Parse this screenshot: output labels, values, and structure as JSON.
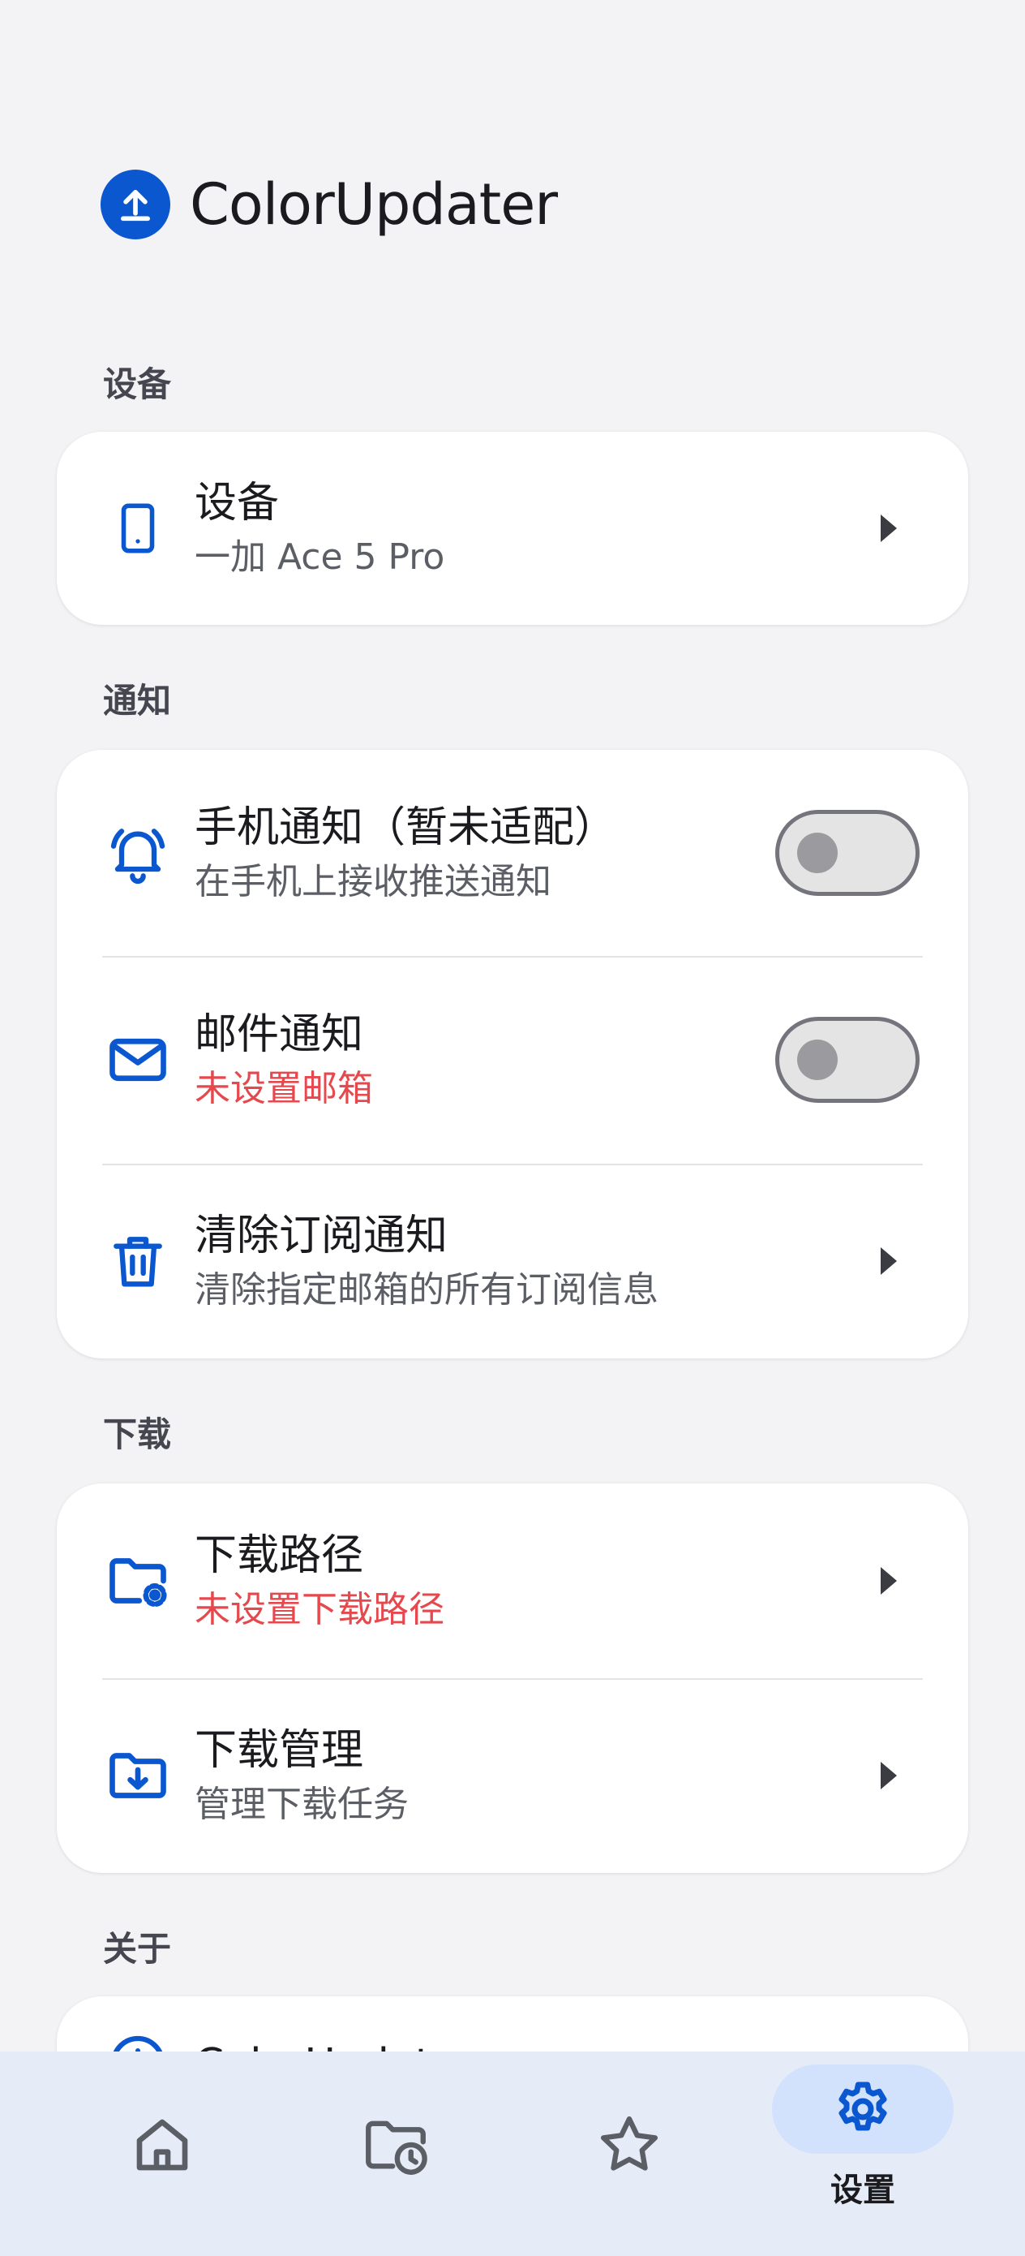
{
  "app": {
    "title": "ColorUpdater",
    "logo_icon": "upload-circle-icon",
    "accent": "#0b57d0",
    "warn_color": "#e5484d"
  },
  "sections": {
    "device": {
      "label": "设备",
      "items": [
        {
          "icon": "phone-icon",
          "title": "设备",
          "subtitle": "一加 Ace 5 Pro"
        }
      ]
    },
    "notify": {
      "label": "通知",
      "items": [
        {
          "icon": "bell-icon",
          "title": "手机通知（暂未适配）",
          "subtitle": "在手机上接收推送通知",
          "toggle": false
        },
        {
          "icon": "mail-icon",
          "title": "邮件通知",
          "subtitle": "未设置邮箱",
          "toggle": false
        },
        {
          "icon": "trash-icon",
          "title": "清除订阅通知",
          "subtitle": "清除指定邮箱的所有订阅信息"
        }
      ]
    },
    "download": {
      "label": "下载",
      "items": [
        {
          "icon": "folder-settings-icon",
          "title": "下载路径",
          "subtitle": "未设置下载路径"
        },
        {
          "icon": "folder-download-icon",
          "title": "下载管理",
          "subtitle": "管理下载任务"
        }
      ]
    },
    "about": {
      "label": "关于",
      "items": [
        {
          "icon": "info-icon",
          "title": "ColorUpdater"
        }
      ]
    }
  },
  "bottom_nav": {
    "items": [
      {
        "icon": "home-icon",
        "label": ""
      },
      {
        "icon": "folder-clock-icon",
        "label": ""
      },
      {
        "icon": "star-icon",
        "label": ""
      },
      {
        "icon": "settings-gear-icon",
        "label": "设置",
        "active": true
      }
    ]
  }
}
